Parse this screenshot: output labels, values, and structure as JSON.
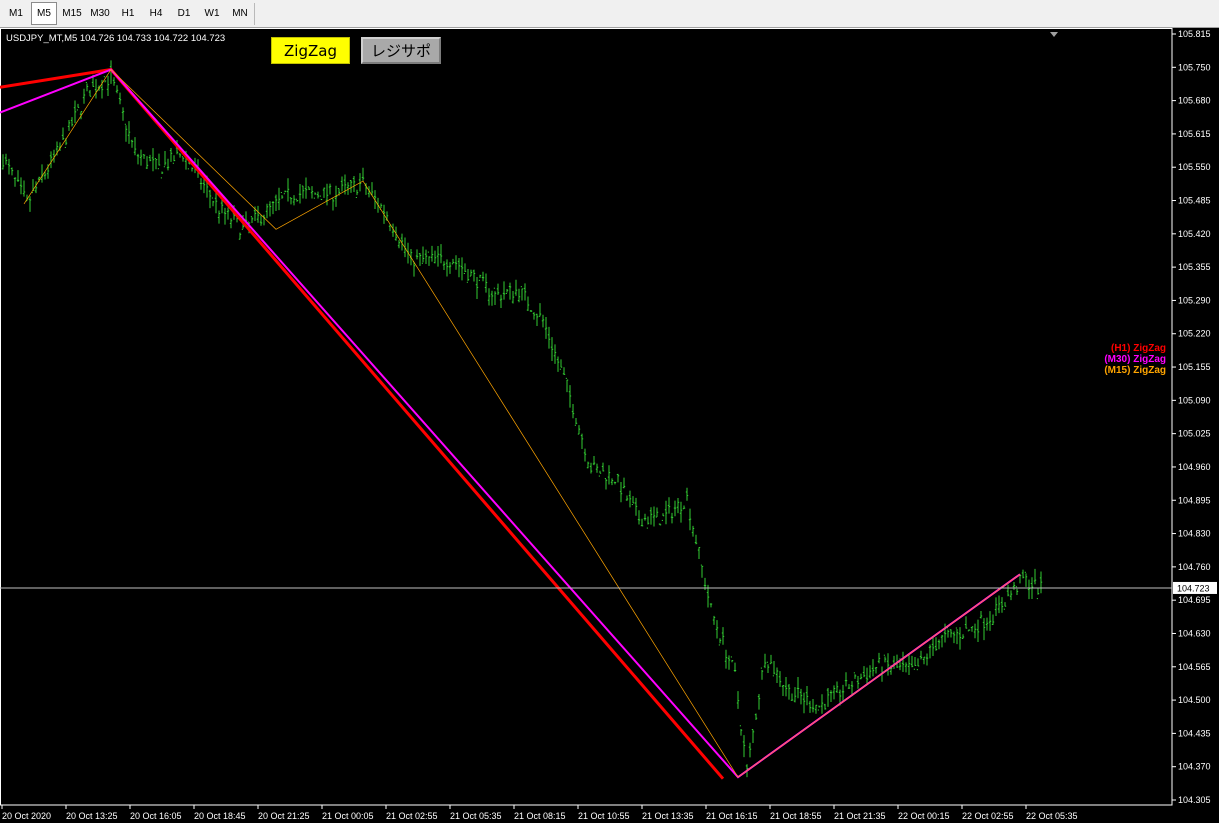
{
  "toolbar": {
    "timeframes": [
      "M1",
      "M5",
      "M15",
      "M30",
      "H1",
      "H4",
      "D1",
      "W1",
      "MN"
    ],
    "active": "M5"
  },
  "symbol_info": "USDJPY_MT,M5  104.726 104.733 104.722 104.723",
  "buttons": {
    "zigzag": {
      "label": "ZigZag",
      "bg": "#ffff00"
    },
    "sr": {
      "label": "レジサポ",
      "bg": "#a9a9a9"
    }
  },
  "legend": [
    {
      "label": "(H1) ZigZag",
      "color": "#ff0000"
    },
    {
      "label": "(M30) ZigZag",
      "color": "#ff00ff"
    },
    {
      "label": "(M15) ZigZag",
      "color": "#ffa500"
    }
  ],
  "current_price": "104.723",
  "colors": {
    "background": "#000000",
    "candles": "#32cd32",
    "grid": "#ffffff"
  },
  "chart_data": {
    "type": "line",
    "symbol": "USDJPY_MT",
    "timeframe": "M5",
    "ylim": [
      104.27,
      105.855
    ],
    "y_ticks": [
      "105.815",
      "105.750",
      "105.680",
      "105.615",
      "105.550",
      "105.485",
      "105.420",
      "105.355",
      "105.290",
      "105.220",
      "105.155",
      "105.090",
      "105.025",
      "104.960",
      "104.895",
      "104.830",
      "104.760",
      "104.695",
      "104.630",
      "104.565",
      "104.500",
      "104.435",
      "104.370",
      "104.305"
    ],
    "x_ticks": [
      "20 Oct 2020",
      "20 Oct 13:25",
      "20 Oct 16:05",
      "20 Oct 18:45",
      "20 Oct 21:25",
      "21 Oct 00:05",
      "21 Oct 02:55",
      "21 Oct 05:35",
      "21 Oct 08:15",
      "21 Oct 10:55",
      "21 Oct 13:35",
      "21 Oct 16:15",
      "21 Oct 18:55",
      "21 Oct 21:35",
      "22 Oct 00:15",
      "22 Oct 02:55",
      "22 Oct 05:35"
    ],
    "price_path": [
      {
        "bar": 0,
        "p": 105.57
      },
      {
        "bar": 8,
        "p": 105.48
      },
      {
        "bar": 20,
        "p": 105.6
      },
      {
        "bar": 28,
        "p": 105.7
      },
      {
        "bar": 36,
        "p": 105.73
      },
      {
        "bar": 44,
        "p": 105.58
      },
      {
        "bar": 52,
        "p": 105.55
      },
      {
        "bar": 60,
        "p": 105.58
      },
      {
        "bar": 72,
        "p": 105.47
      },
      {
        "bar": 80,
        "p": 105.43
      },
      {
        "bar": 96,
        "p": 105.5
      },
      {
        "bar": 110,
        "p": 105.5
      },
      {
        "bar": 120,
        "p": 105.52
      },
      {
        "bar": 128,
        "p": 105.46
      },
      {
        "bar": 136,
        "p": 105.37
      },
      {
        "bar": 150,
        "p": 105.37
      },
      {
        "bar": 164,
        "p": 105.3
      },
      {
        "bar": 172,
        "p": 105.31
      },
      {
        "bar": 180,
        "p": 105.25
      },
      {
        "bar": 188,
        "p": 105.12
      },
      {
        "bar": 196,
        "p": 104.96
      },
      {
        "bar": 204,
        "p": 104.94
      },
      {
        "bar": 212,
        "p": 104.86
      },
      {
        "bar": 220,
        "p": 104.86
      },
      {
        "bar": 228,
        "p": 104.9
      },
      {
        "bar": 236,
        "p": 104.68
      },
      {
        "bar": 244,
        "p": 104.55
      },
      {
        "bar": 248,
        "p": 104.36
      },
      {
        "bar": 254,
        "p": 104.59
      },
      {
        "bar": 262,
        "p": 104.52
      },
      {
        "bar": 272,
        "p": 104.49
      },
      {
        "bar": 282,
        "p": 104.53
      },
      {
        "bar": 292,
        "p": 104.57
      },
      {
        "bar": 304,
        "p": 104.56
      },
      {
        "bar": 312,
        "p": 104.62
      },
      {
        "bar": 322,
        "p": 104.64
      },
      {
        "bar": 330,
        "p": 104.67
      },
      {
        "bar": 340,
        "p": 104.74
      },
      {
        "bar": 346,
        "p": 104.72
      }
    ],
    "series": [
      {
        "name": "(H1) ZigZag",
        "points": [
          {
            "x": "20 Oct 2020",
            "y": 105.71
          },
          {
            "x": "20 Oct 13:35",
            "y": 105.745
          },
          {
            "x": "21 Oct 16:05",
            "y": 104.347
          }
        ]
      },
      {
        "name": "(M30) ZigZag",
        "points": [
          {
            "x": "20 Oct 2020",
            "y": 105.66
          },
          {
            "x": "20 Oct 13:35",
            "y": 105.745
          },
          {
            "x": "21 Oct 16:15",
            "y": 104.35
          },
          {
            "x": "22 Oct 05:10",
            "y": 104.75
          }
        ]
      },
      {
        "name": "(M15) ZigZag",
        "points": [
          {
            "x": "20 Oct 12:05",
            "y": 105.48
          },
          {
            "x": "20 Oct 13:35",
            "y": 105.745
          },
          {
            "x": "20 Oct 20:55",
            "y": 105.43
          },
          {
            "x": "21 Oct 00:35",
            "y": 105.525
          },
          {
            "x": "21 Oct 16:15",
            "y": 104.35
          },
          {
            "x": "22 Oct 05:10",
            "y": 104.75
          }
        ]
      }
    ]
  }
}
